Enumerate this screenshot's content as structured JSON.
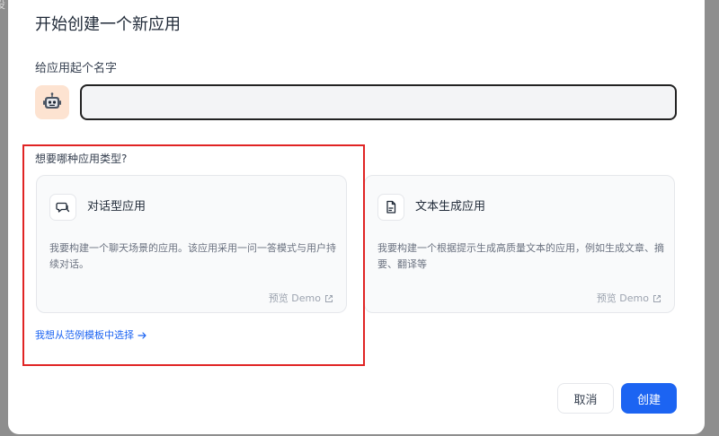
{
  "background": {
    "partial_text": "设"
  },
  "dialog": {
    "title": "开始创建一个新应用",
    "name_label": "给应用起个名字",
    "name_input": {
      "value": "",
      "placeholder": ""
    },
    "type_label": "想要哪种应用类型?",
    "cards": [
      {
        "icon": "chat-bubble-icon",
        "title": "对话型应用",
        "desc": "我要构建一个聊天场景的应用。该应用采用一问一答模式与用户持续对话。",
        "demo": "预览 Demo"
      },
      {
        "icon": "document-icon",
        "title": "文本生成应用",
        "desc": "我要构建一个根据提示生成高质量文本的应用，例如生成文章、摘要、翻译等",
        "demo": "预览 Demo"
      }
    ],
    "template_link": "我想从范例模板中选择",
    "cancel_label": "取消",
    "create_label": "创建"
  },
  "colors": {
    "primary": "#1c64f2",
    "highlight": "#e02424",
    "avatar_bg": "#fde3d1"
  }
}
